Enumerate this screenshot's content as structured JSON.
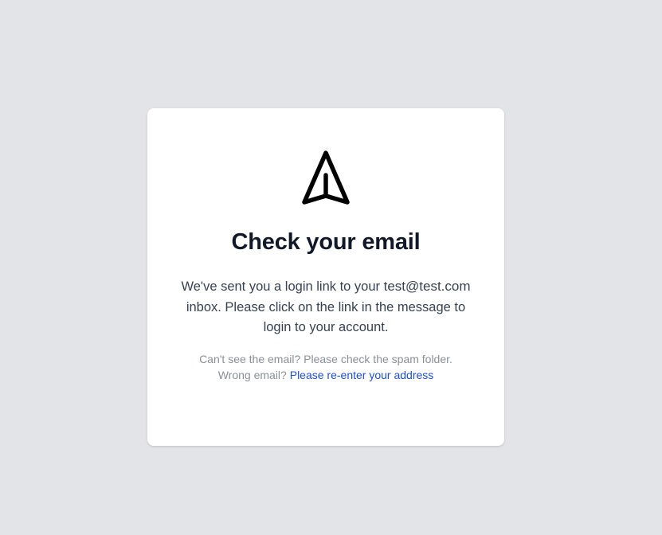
{
  "card": {
    "icon": "paper-plane-icon",
    "title": "Check your email",
    "message_part1": "We've sent you a login link to your",
    "email": "test@test.com",
    "message_part2": "inbox. Please click on the link in the message to login to your account.",
    "help_line1": "Can't see the email? Please check the spam folder.",
    "help_line2_prefix": "Wrong email?",
    "reenter_link": "Please re-enter your address"
  },
  "colors": {
    "background": "#e3e4e8",
    "card": "#ffffff",
    "title": "#111827",
    "body_text": "#374151",
    "muted_text": "#8a8f98",
    "link": "#1d4ed8"
  }
}
